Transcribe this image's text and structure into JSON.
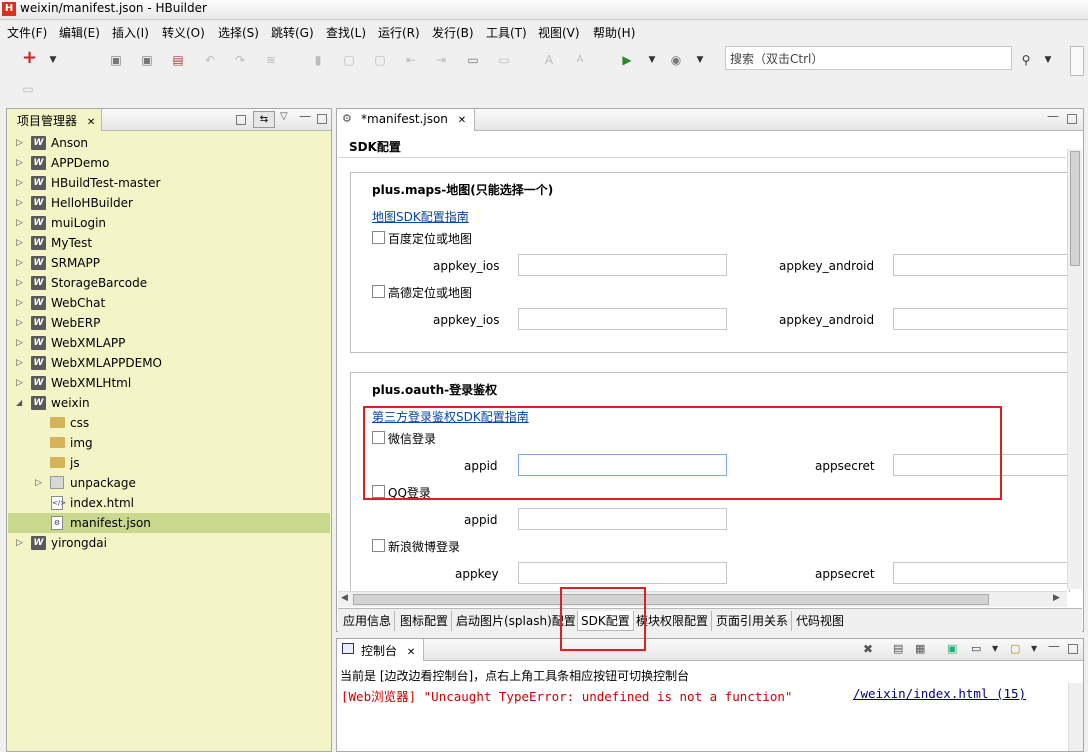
{
  "window": {
    "title": "weixin/manifest.json  -  HBuilder",
    "app_icon": "H"
  },
  "menu": [
    "文件(F)",
    "编辑(E)",
    "插入(I)",
    "转义(O)",
    "选择(S)",
    "跳转(G)",
    "查找(L)",
    "运行(R)",
    "发行(B)",
    "工具(T)",
    "视图(V)",
    "帮助(H)"
  ],
  "search": {
    "placeholder": "搜索（双击Ctrl）"
  },
  "project_panel": {
    "title": "项目管理器",
    "items": [
      {
        "label": "Anson",
        "type": "project",
        "expanded": false
      },
      {
        "label": "APPDemo",
        "type": "project",
        "expanded": false
      },
      {
        "label": "HBuildTest-master",
        "type": "project",
        "expanded": false
      },
      {
        "label": "HelloHBuilder",
        "type": "project",
        "expanded": false
      },
      {
        "label": "muiLogin",
        "type": "project",
        "expanded": false
      },
      {
        "label": "MyTest",
        "type": "project",
        "expanded": false
      },
      {
        "label": "SRMAPP",
        "type": "project",
        "expanded": false
      },
      {
        "label": "StorageBarcode",
        "type": "project",
        "expanded": false
      },
      {
        "label": "WebChat",
        "type": "project",
        "expanded": false
      },
      {
        "label": "WebERP",
        "type": "project",
        "expanded": false
      },
      {
        "label": "WebXMLAPP",
        "type": "project",
        "expanded": false
      },
      {
        "label": "WebXMLAPPDEMO",
        "type": "project",
        "expanded": false
      },
      {
        "label": "WebXMLHtml",
        "type": "project",
        "expanded": false
      },
      {
        "label": "weixin",
        "type": "project",
        "expanded": true
      },
      {
        "label": "css",
        "type": "folder"
      },
      {
        "label": "img",
        "type": "folder"
      },
      {
        "label": "js",
        "type": "folder"
      },
      {
        "label": "unpackage",
        "type": "package"
      },
      {
        "label": "index.html",
        "type": "file"
      },
      {
        "label": "manifest.json",
        "type": "file",
        "selected": true
      },
      {
        "label": "yirongdai",
        "type": "project",
        "expanded": false
      }
    ]
  },
  "editor": {
    "tab_label": "*manifest.json",
    "section_title": "SDK配置",
    "maps": {
      "title": "plus.maps-地图(只能选择一个)",
      "guide_link": "地图SDK配置指南",
      "baidu_label": "百度定位或地图",
      "gaode_label": "高德定位或地图",
      "appkey_ios": "appkey_ios",
      "appkey_android": "appkey_android"
    },
    "oauth": {
      "title": "plus.oauth-登录鉴权",
      "guide_link": "第三方登录鉴权SDK配置指南",
      "weixin_label": "微信登录",
      "qq_label": "QQ登录",
      "weibo_label": "新浪微博登录",
      "appid": "appid",
      "appsecret": "appsecret",
      "appkey": "appkey"
    },
    "bottom_tabs": [
      "应用信息",
      "图标配置",
      "启动图片(splash)配置",
      "SDK配置",
      "模块权限配置",
      "页面引用关系",
      "代码视图"
    ],
    "active_tab": "SDK配置"
  },
  "console": {
    "title": "控制台",
    "info": "当前是 [边改边看控制台]，点右上角工具条相应按钮可切换控制台",
    "error": "[Web浏览器] \"Uncaught TypeError: undefined is not a function\"",
    "error_link": "/weixin/index.html (15)"
  },
  "colors": {
    "left_panel_bg": "#f4f5c7",
    "selected_row": "#c8d88c",
    "highlight_box": "#e02020",
    "error_text": "#d40000"
  }
}
